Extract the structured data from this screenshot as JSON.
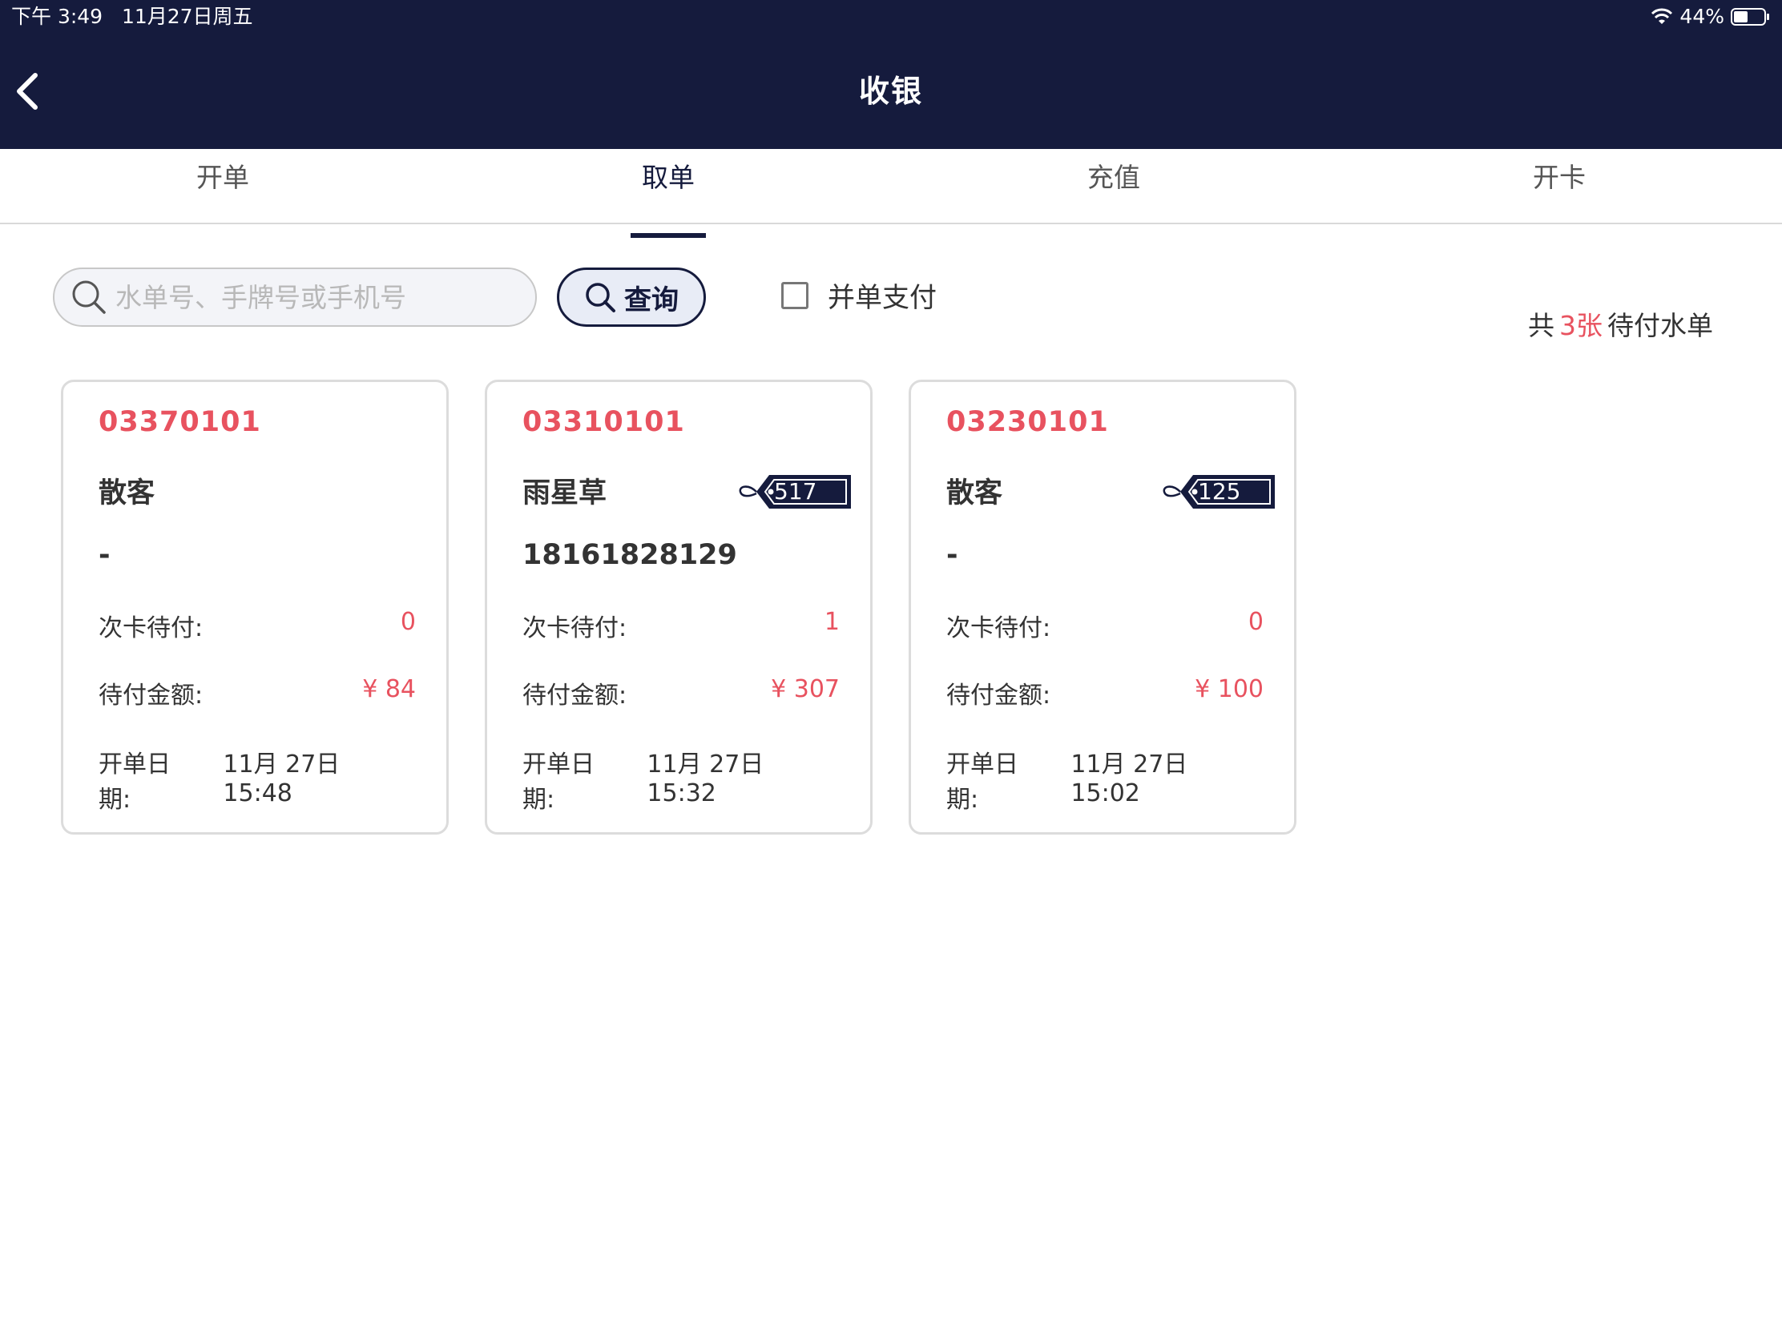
{
  "status_bar": {
    "time": "下午 3:49",
    "date": "11月27日周五",
    "battery": "44%"
  },
  "header": {
    "title": "收银"
  },
  "tabs": [
    {
      "label": "开单"
    },
    {
      "label": "取单"
    },
    {
      "label": "充值"
    },
    {
      "label": "开卡"
    }
  ],
  "active_tab": "取单",
  "search": {
    "placeholder": "水单号、手牌号或手机号",
    "value": "",
    "button_label": "查询"
  },
  "merge_pay": {
    "label": "并单支付",
    "checked": false
  },
  "summary": {
    "prefix": "共",
    "count": "3张",
    "suffix": "待付水单"
  },
  "orders": [
    {
      "order_no": "03370101",
      "customer": "散客",
      "phone": "-",
      "tag": "",
      "card_pending_label": "次卡待付:",
      "card_pending": "0",
      "amount_label": "待付金额:",
      "amount": "¥ 84",
      "date_label": "开单日期:",
      "date": "11月 27日 15:48"
    },
    {
      "order_no": "03310101",
      "customer": "雨星草",
      "phone": "18161828129",
      "tag": "517",
      "card_pending_label": "次卡待付:",
      "card_pending": "1",
      "amount_label": "待付金额:",
      "amount": "¥ 307",
      "date_label": "开单日期:",
      "date": "11月 27日 15:32"
    },
    {
      "order_no": "03230101",
      "customer": "散客",
      "phone": "-",
      "tag": "125",
      "card_pending_label": "次卡待付:",
      "card_pending": "0",
      "amount_label": "待付金额:",
      "amount": "¥ 100",
      "date_label": "开单日期:",
      "date": "11月 27日 15:02"
    }
  ],
  "colors": {
    "header_bg": "#151b3d",
    "accent_red": "#e8525f",
    "card_border": "#dcdcdc"
  }
}
